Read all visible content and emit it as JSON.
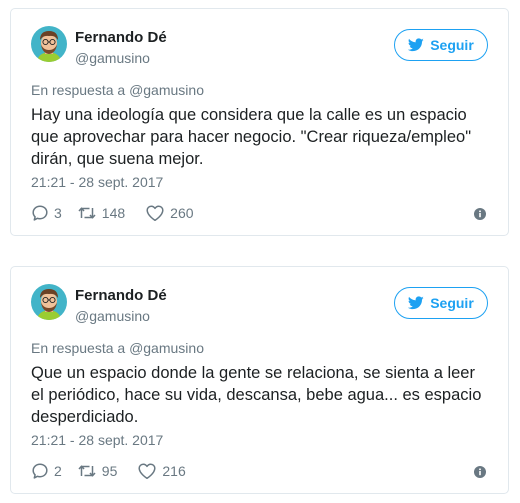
{
  "colors": {
    "accent": "#1da1f2",
    "text": "#1c2022",
    "secondary": "#697882",
    "border": "#e1e8ed"
  },
  "tweets": [
    {
      "author": {
        "name": "Fernando Dé",
        "handle": "@gamusino",
        "avatar_icon": "avatar-illustration"
      },
      "follow_label": "Seguir",
      "follow_icon": "twitter-bird-icon",
      "reply_prefix": "En respuesta a ",
      "reply_to": "@gamusino",
      "text": "Hay una ideología que considera que la calle es un espacio que aprovechar para hacer negocio. \"Crear riqueza/empleo\" dirán, que suena mejor.",
      "timestamp": "21:21 - 28 sept. 2017",
      "replies": "3",
      "retweets": "148",
      "likes": "260"
    },
    {
      "author": {
        "name": "Fernando Dé",
        "handle": "@gamusino",
        "avatar_icon": "avatar-illustration"
      },
      "follow_label": "Seguir",
      "follow_icon": "twitter-bird-icon",
      "reply_prefix": "En respuesta a ",
      "reply_to": "@gamusino",
      "text": "Que un espacio donde la gente se relaciona, se sienta a leer el periódico, hace su vida, descansa, bebe agua... es espacio desperdiciado.",
      "timestamp": "21:21 - 28 sept. 2017",
      "replies": "2",
      "retweets": "95",
      "likes": "216"
    }
  ]
}
